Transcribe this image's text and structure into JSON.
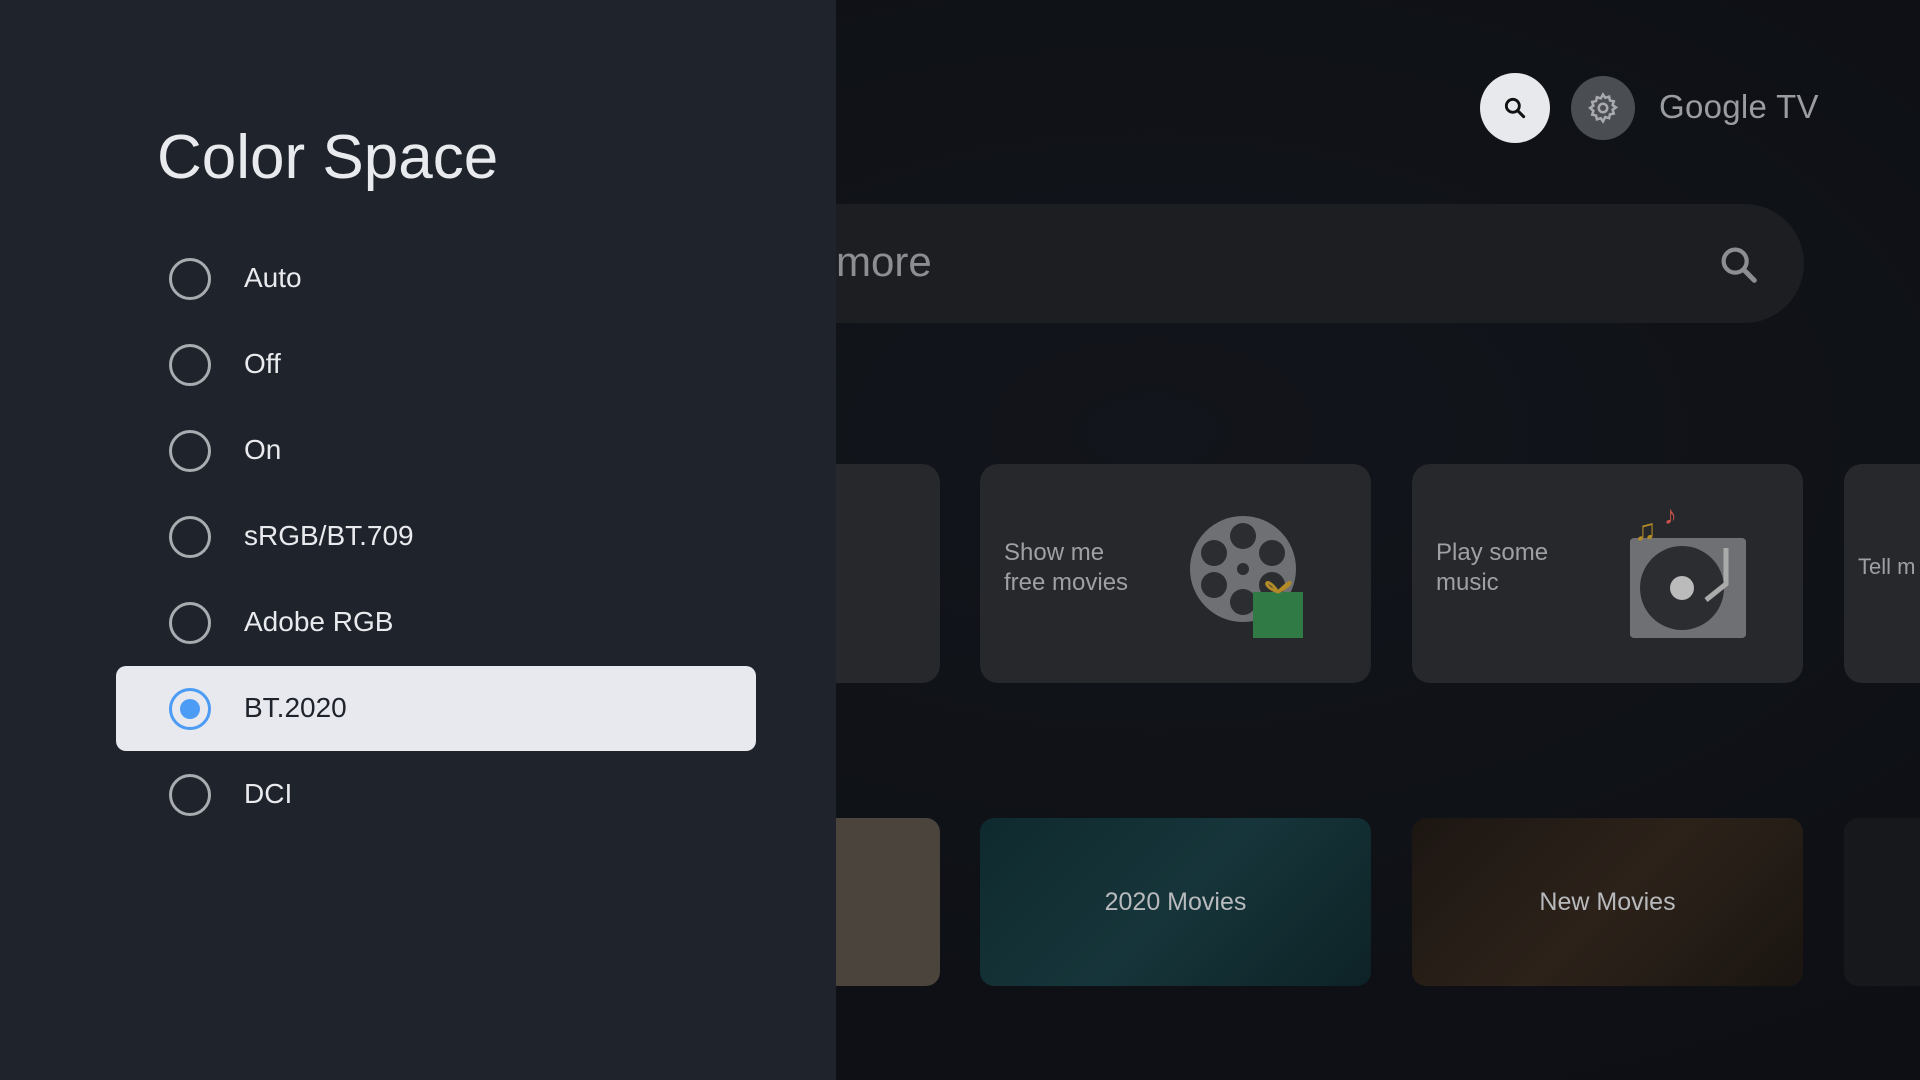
{
  "panel": {
    "title": "Color Space",
    "options": [
      {
        "label": "Auto",
        "selected": false
      },
      {
        "label": "Off",
        "selected": false
      },
      {
        "label": "On",
        "selected": false
      },
      {
        "label": "sRGB/BT.709",
        "selected": false
      },
      {
        "label": "Adobe RGB",
        "selected": false
      },
      {
        "label": "BT.2020",
        "selected": true
      },
      {
        "label": "DCI",
        "selected": false
      }
    ]
  },
  "header": {
    "brand": "Google TV",
    "search_icon": "search-icon",
    "settings_icon": "gear-icon"
  },
  "searchbar": {
    "text": "more"
  },
  "cards": [
    {
      "label": "Show me free movies",
      "line1": "Show me",
      "line2": "free movies"
    },
    {
      "label": "Play some music",
      "line1": "Play some",
      "line2": "music"
    },
    {
      "label": "Tell m"
    }
  ],
  "tiles": [
    {
      "label": "2020 Movies"
    },
    {
      "label": "New Movies"
    }
  ],
  "colors": {
    "accent": "#4c9cf5",
    "panel": "#1f232b",
    "selected_row": "#e8e9ee"
  }
}
